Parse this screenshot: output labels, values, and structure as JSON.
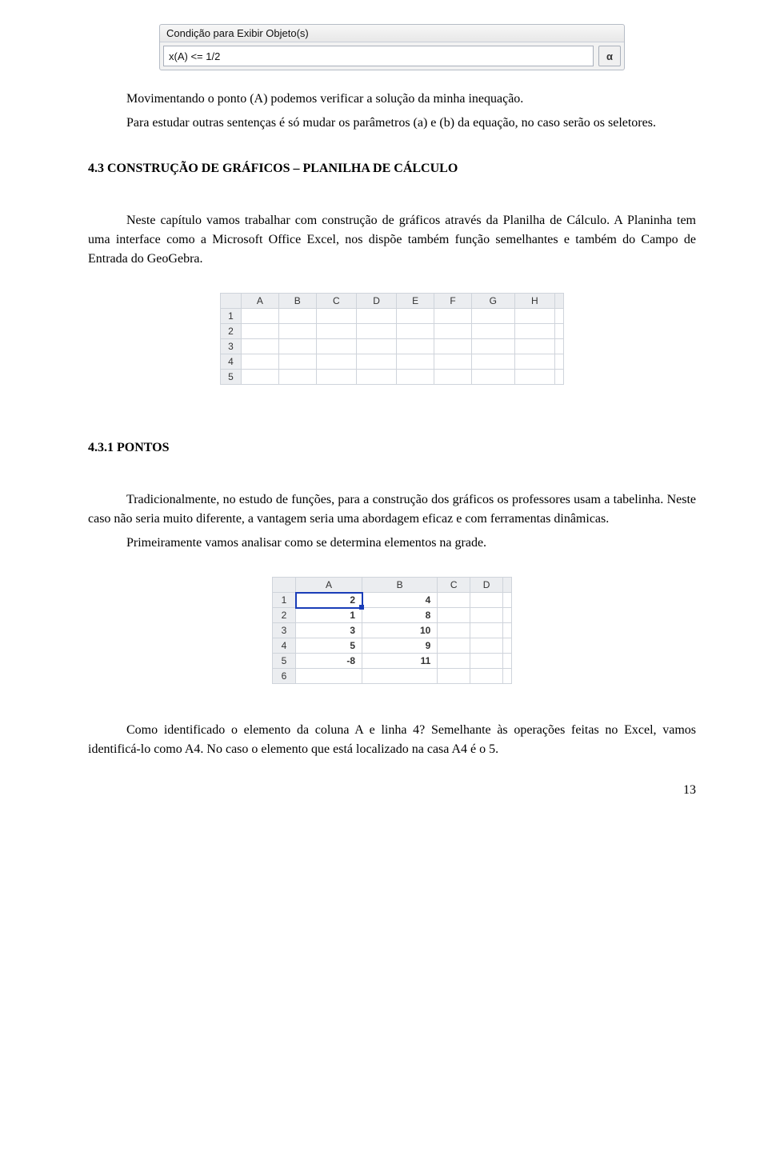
{
  "dialog": {
    "title": "Condição para Exibir Objeto(s)",
    "input_value": "x(A) <= 1/2",
    "alpha_label": "α"
  },
  "p1a": "Movimentando o ponto (A) podemos verificar a solução da minha inequação.",
  "p1b": "Para estudar outras sentenças é só mudar os parâmetros (a) e (b) da equação, no caso serão os seletores.",
  "section43": "4.3 CONSTRUÇÃO DE GRÁFICOS – PLANILHA DE CÁLCULO",
  "p2": "Neste capítulo vamos trabalhar com construção de gráficos através da Planilha de Cálculo. A Planinha tem uma interface como a Microsoft Office Excel, nos dispõe também função semelhantes e também do Campo de Entrada do GeoGebra.",
  "sheet1": {
    "cols": [
      "A",
      "B",
      "C",
      "D",
      "E",
      "F",
      "G",
      "H"
    ],
    "rows": [
      "1",
      "2",
      "3",
      "4",
      "5"
    ]
  },
  "sub431": "4.3.1   PONTOS",
  "p3": "Tradicionalmente, no estudo de funções, para a construção dos gráficos os professores usam a tabelinha. Neste caso não seria muito diferente, a vantagem seria uma abordagem eficaz e com ferramentas dinâmicas.",
  "p4": "Primeiramente vamos analisar como se determina elementos na grade.",
  "sheet2": {
    "cols": [
      "A",
      "B",
      "C",
      "D"
    ],
    "rows": [
      {
        "hdr": "1",
        "a": "2",
        "b": "4"
      },
      {
        "hdr": "2",
        "a": "1",
        "b": "8"
      },
      {
        "hdr": "3",
        "a": "3",
        "b": "10"
      },
      {
        "hdr": "4",
        "a": "5",
        "b": "9"
      },
      {
        "hdr": "5",
        "a": "-8",
        "b": "11"
      },
      {
        "hdr": "6",
        "a": "",
        "b": ""
      }
    ]
  },
  "p5": "Como identificado o elemento da coluna A e linha 4? Semelhante às operações feitas no Excel, vamos identificá-lo como A4. No caso o elemento que está localizado na casa A4 é o 5.",
  "pagenum": "13"
}
